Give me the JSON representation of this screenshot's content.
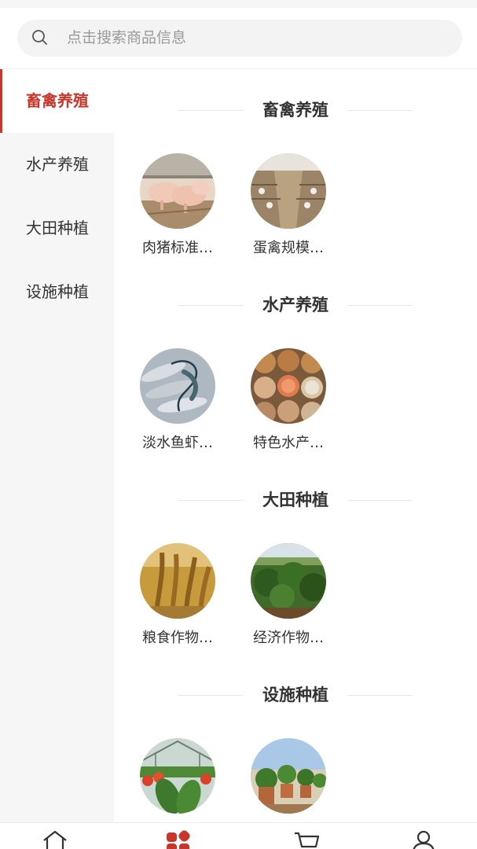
{
  "search": {
    "placeholder": "点击搜索商品信息",
    "icon": "search-icon"
  },
  "sidebar": {
    "items": [
      {
        "label": "畜禽养殖",
        "active": true
      },
      {
        "label": "水产养殖",
        "active": false
      },
      {
        "label": "大田种植",
        "active": false
      },
      {
        "label": "设施种植",
        "active": false
      }
    ]
  },
  "sections": [
    {
      "title": "畜禽养殖",
      "items": [
        {
          "label": "肉猪标准…"
        },
        {
          "label": "蛋禽规模…"
        }
      ]
    },
    {
      "title": "水产养殖",
      "items": [
        {
          "label": "淡水鱼虾…"
        },
        {
          "label": "特色水产…"
        }
      ]
    },
    {
      "title": "大田种植",
      "items": [
        {
          "label": "粮食作物…"
        },
        {
          "label": "经济作物…"
        }
      ]
    },
    {
      "title": "设施种植",
      "items": [
        {
          "label": ""
        },
        {
          "label": ""
        }
      ]
    }
  ],
  "tabbar": {
    "tabs": [
      "home-icon",
      "category-icon",
      "cart-icon",
      "user-icon"
    ],
    "active_index": 1
  },
  "colors": {
    "accent": "#c8352b",
    "sidebar_bg": "#f6f6f6",
    "search_bg": "#f3f3f3"
  }
}
